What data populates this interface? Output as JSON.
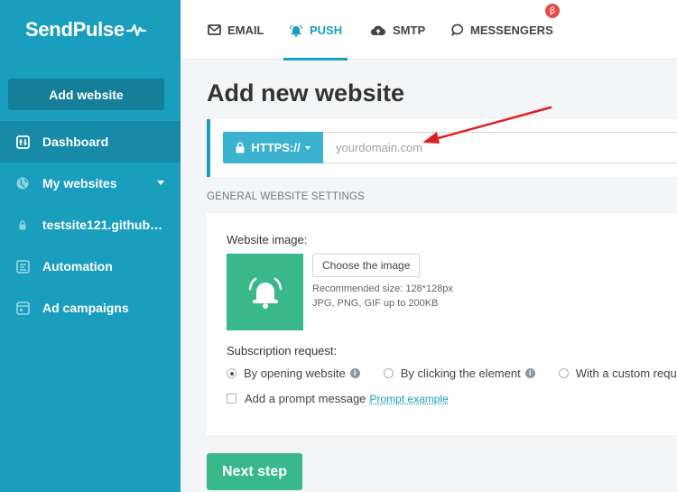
{
  "brand": {
    "name": "SendPulse"
  },
  "sidebar": {
    "add_button": "Add website",
    "items": [
      {
        "label": "Dashboard",
        "icon": "dashboard-icon"
      },
      {
        "label": "My websites",
        "icon": "globe-icon"
      },
      {
        "label": "testsite121.github…",
        "icon": "lock-icon"
      },
      {
        "label": "Automation",
        "icon": "automation-icon"
      },
      {
        "label": "Ad campaigns",
        "icon": "ad-campaigns-icon"
      }
    ]
  },
  "tabs": [
    {
      "label": "EMAIL",
      "icon": "mail-icon"
    },
    {
      "label": "PUSH",
      "icon": "bell-icon"
    },
    {
      "label": "SMTP",
      "icon": "cloud-upload-icon"
    },
    {
      "label": "MESSENGERS",
      "icon": "chat-icon"
    }
  ],
  "beta_badge": "β",
  "main": {
    "title": "Add new website",
    "protocol_label": "HTTPS://",
    "domain_placeholder": "yourdomain.com",
    "section_label": "GENERAL WEBSITE SETTINGS",
    "website_image_label": "Website image:",
    "choose_image_label": "Choose the image",
    "image_hint_size": "Recommended size: 128*128px",
    "image_hint_format": "JPG, PNG, GIF up to 200KB",
    "subscription_label": "Subscription request:",
    "options": [
      {
        "label": "By opening website",
        "checked": true
      },
      {
        "label": "By clicking the element",
        "checked": false
      },
      {
        "label": "With a custom requ",
        "checked": false
      }
    ],
    "prompt_checkbox_label": "Add a prompt message",
    "prompt_example_link": "Prompt example",
    "next_button": "Next step"
  },
  "colors": {
    "accent": "#1a9ebd",
    "green": "#38b88b",
    "arrow": "#e02020",
    "badge": "#e24c4b"
  }
}
